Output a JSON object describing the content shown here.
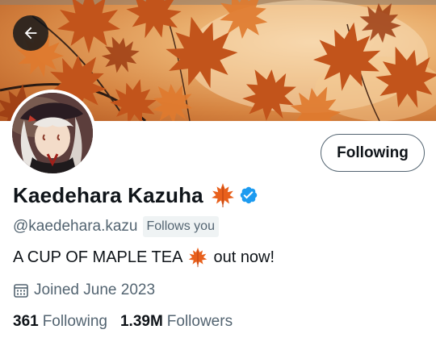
{
  "header": {
    "back_icon": "arrow-left-icon",
    "banner_description_colors": [
      "#f6d2a3",
      "#d58340",
      "#b3561f"
    ]
  },
  "profile": {
    "display_name": "Kaedehara Kazuha",
    "name_emoji": "maple-leaf-icon",
    "verified_icon": "verified-badge-icon",
    "verified_color": "#1d9bf0",
    "handle": "@kaedehara.kazu",
    "follows_you": "Follows you",
    "follow_button_label": "Following",
    "bio": {
      "before": "A CUP OF MAPLE TEA",
      "emoji": "maple-leaf-icon",
      "after": "out now!"
    },
    "joined": "Joined June 2023",
    "calendar_icon": "calendar-icon"
  },
  "stats": {
    "following_count": "361",
    "following_label": "Following",
    "followers_count": "1.39M",
    "followers_label": "Followers"
  },
  "colors": {
    "text_primary": "#0f1419",
    "text_secondary": "#536471",
    "verified": "#1d9bf0",
    "maple": "#e8601c"
  }
}
